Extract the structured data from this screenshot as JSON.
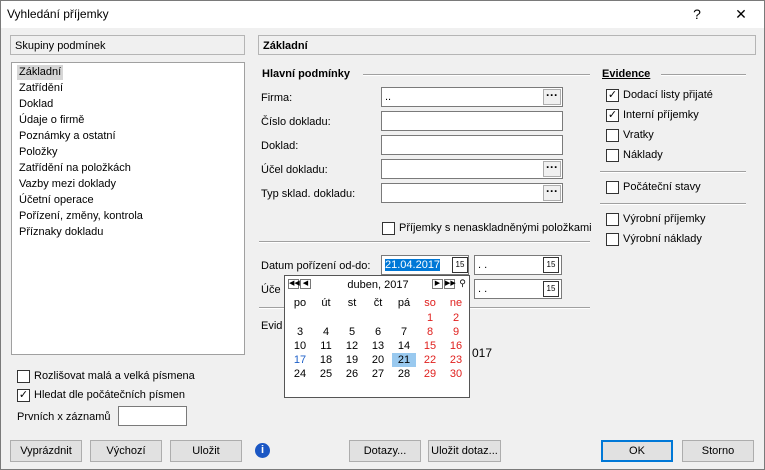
{
  "window": {
    "title": "Vyhledání příjemky",
    "help": "?",
    "close": "✕"
  },
  "left": {
    "header": "Skupiny podmínek",
    "items": [
      "Základní",
      "Zatřídění",
      "Doklad",
      "Údaje o firmě",
      "Poznámky a ostatní",
      "Položky",
      "Zatřídění na položkách",
      "Vazby mezi doklady",
      "Účetní operace",
      "Pořízení, změny, kontrola",
      "Příznaky dokladu"
    ],
    "selected": 0
  },
  "right": {
    "header": "Základní"
  },
  "main_conditions": {
    "title": "Hlavní podmínky",
    "firma_label": "Firma:",
    "firma_value": "..",
    "cislo_label": "Číslo dokladu:",
    "doklad_label": "Doklad:",
    "ucel_label": "Účel dokladu:",
    "typ_label": "Typ sklad. dokladu:",
    "nenaskl_label": "Příjemky s nenaskladněnými položkami"
  },
  "dates": {
    "datum_label": "Datum pořízení od-do:",
    "date_from": "21.04.2017",
    "date_to": ". .",
    "ucet_label": "Úče",
    "ucet_to": ". .",
    "evid_label": "Evid",
    "partial_text": "017"
  },
  "evidence": {
    "title": "Evidence",
    "items": [
      {
        "label": "Dodací listy přijaté",
        "checked": true
      },
      {
        "label": "Interní příjemky",
        "checked": true
      },
      {
        "label": "Vratky",
        "checked": false
      },
      {
        "label": "Náklady",
        "checked": false
      },
      {
        "label": "Počáteční stavy",
        "checked": false
      },
      {
        "label": "Výrobní příjemky",
        "checked": false
      },
      {
        "label": "Výrobní náklady",
        "checked": false
      }
    ]
  },
  "calendar": {
    "month": "duben, 2017",
    "weekdays": [
      "po",
      "út",
      "st",
      "čt",
      "pá",
      "so",
      "ne"
    ],
    "weeks": [
      [
        "",
        "",
        "",
        "",
        "",
        "1",
        "2"
      ],
      [
        "3",
        "4",
        "5",
        "6",
        "7",
        "8",
        "9"
      ],
      [
        "10",
        "11",
        "12",
        "13",
        "14",
        "15",
        "16"
      ],
      [
        "17",
        "18",
        "19",
        "20",
        "21",
        "22",
        "23"
      ],
      [
        "24",
        "25",
        "26",
        "27",
        "28",
        "29",
        "30"
      ]
    ],
    "today": "21",
    "highlighted": "17"
  },
  "options": {
    "case_label": "Rozlišovat malá a velká písmena",
    "prefix_label": "Hledat dle počátečních písmen",
    "first_label": "Prvních x záznamů"
  },
  "buttons": {
    "clear": "Vyprázdnit",
    "default": "Výchozí",
    "save": "Uložit",
    "queries": "Dotazy...",
    "save_query": "Uložit dotaz...",
    "ok": "OK",
    "cancel": "Storno"
  },
  "colors": {
    "accent": "#0078d7",
    "weekend": "#e0201e",
    "selection": "#99c9ef"
  }
}
